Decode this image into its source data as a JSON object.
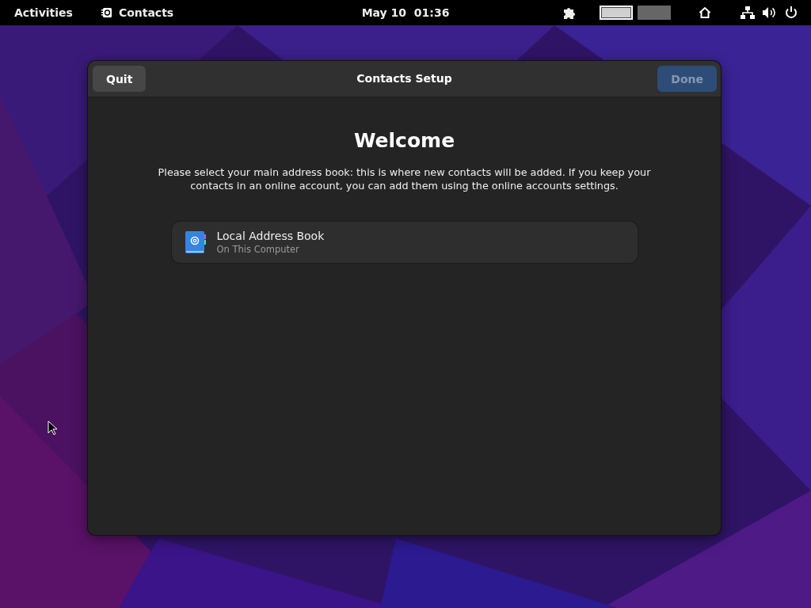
{
  "top_bar": {
    "activities": "Activities",
    "app_menu": "Contacts",
    "clock": "May 10  01:36",
    "workspaces": [
      {
        "selected": true
      },
      {
        "selected": false
      }
    ]
  },
  "window": {
    "title": "Contacts Setup",
    "buttons": [
      {
        "kind": "quit",
        "label": "Quit",
        "disabled": false
      },
      {
        "kind": "done",
        "label": "Done",
        "disabled": true
      }
    ],
    "heading": "Welcome",
    "description": "Please select your main address book: this is where new contacts will be added. If you keep your contacts in an online account, you can add them using the online accounts settings.",
    "address_books": [
      {
        "name": "Local Address Book",
        "location": "On This Computer"
      }
    ]
  }
}
